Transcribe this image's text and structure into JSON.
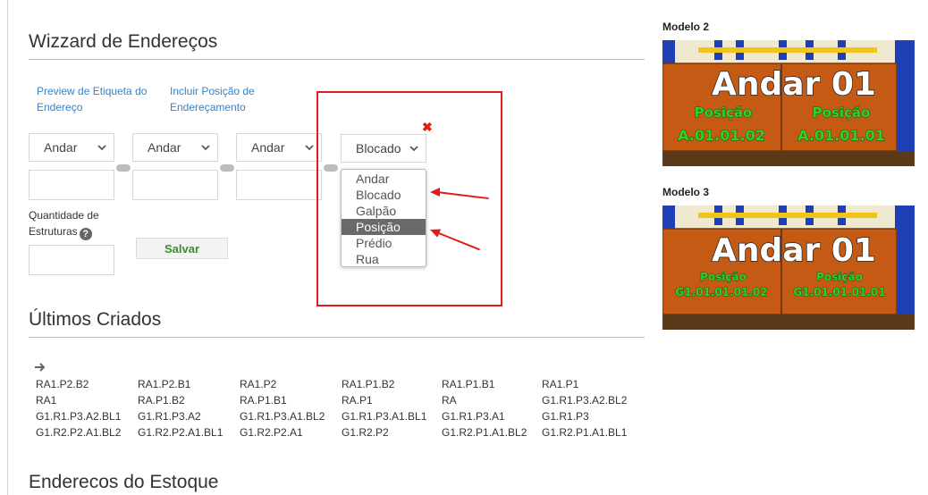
{
  "wizard": {
    "title": "Wizzard de Endereços",
    "links": [
      "Preview de Etiqueta do Endereço",
      "Incluir Posição de Endereçamento"
    ],
    "selects": [
      "Andar",
      "Andar",
      "Andar",
      "Blocado"
    ],
    "quantity_label": "Quantidade de Estruturas",
    "help_icon": "question-circle-icon",
    "save_label": "Salvar",
    "close_icon": "✖"
  },
  "dropdown": {
    "options": [
      "Andar",
      "Blocado",
      "Galpão",
      "Posição",
      "Prédio",
      "Rua"
    ],
    "highlighted": "Posição"
  },
  "recent": {
    "title": "Últimos Criados",
    "arrow_icon": "arrow-right-icon",
    "items": [
      "RA1.P2.B2",
      "RA1.P2.B1",
      "RA1.P2",
      "RA1.P1.B2",
      "RA1.P1.B1",
      "RA1.P1",
      "RA1",
      "RA.P1.B2",
      "RA.P1.B1",
      "RA.P1",
      "RA",
      "G1.R1.P3.A2.BL2",
      "G1.R1.P3.A2.BL1",
      "G1.R1.P3.A2",
      "G1.R1.P3.A1.BL2",
      "G1.R1.P3.A1.BL1",
      "G1.R1.P3.A1",
      "G1.R1.P3",
      "G1.R2.P2.A1.BL2",
      "G1.R2.P2.A1.BL1",
      "G1.R2.P2.A1",
      "G1.R2.P2",
      "G1.R2.P1.A1.BL2",
      "G1.R2.P1.A1.BL1"
    ]
  },
  "stock": {
    "title": "Enderecos do Estoque"
  },
  "models": [
    {
      "label": "Modelo 2",
      "title": "Andar 01",
      "cells": [
        {
          "k": "Posição",
          "v": "A.01.01.02"
        },
        {
          "k": "Posição",
          "v": "A.01.01.01"
        }
      ]
    },
    {
      "label": "Modelo 3",
      "title": "Andar 01",
      "cells": [
        {
          "k": "Posição",
          "v": "G1.01.01.01.02"
        },
        {
          "k": "Posição",
          "v": "G1.01.01.01.01"
        }
      ]
    }
  ],
  "colors": {
    "accent_red": "#e21b1b",
    "link_blue": "#3a7fc0",
    "save_green": "#3d8b30",
    "label_green": "#2fd12a"
  }
}
